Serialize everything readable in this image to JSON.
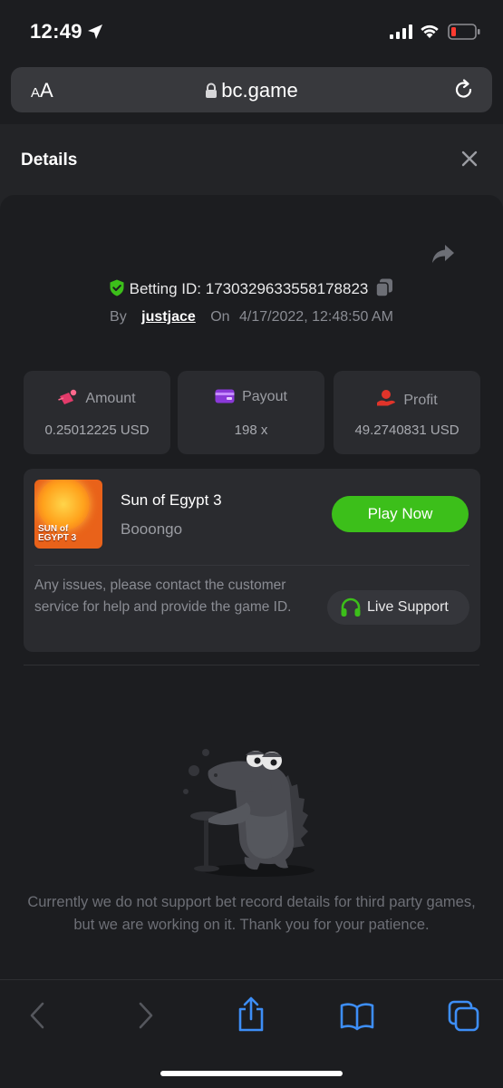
{
  "status_bar": {
    "time": "12:49"
  },
  "url_bar": {
    "text_size_label_small": "A",
    "text_size_label_big": "A",
    "domain": "bc.game"
  },
  "modal": {
    "title": "Details"
  },
  "bet": {
    "betting_id_label": "Betting ID:",
    "betting_id": "1730329633558178823",
    "by_label": "By",
    "username": "justjace",
    "on_label": "On",
    "date": "4/17/2022, 12:48:50 AM"
  },
  "stats": {
    "amount": {
      "label": "Amount",
      "value": "0.25012225 USD"
    },
    "payout": {
      "label": "Payout",
      "value": "198 x"
    },
    "profit": {
      "label": "Profit",
      "value": "49.2740831 USD"
    }
  },
  "game": {
    "name": "Sun of Egypt 3",
    "provider": "Booongo",
    "thumb_text_line1": "SUN of",
    "thumb_text_line2": "EGYPT 3",
    "play_label": "Play Now"
  },
  "support": {
    "message": "Any issues, please contact the customer service for help and provide the game ID.",
    "button_label": "Live Support"
  },
  "notice": "Currently we do not support bet record details for third party games, but we are working on it. Thank you for your patience.",
  "colors": {
    "accent_green": "#3cbf1a",
    "background": "#1c1d20",
    "card": "#2a2b2f",
    "safari_blue": "#3d8ef7"
  }
}
